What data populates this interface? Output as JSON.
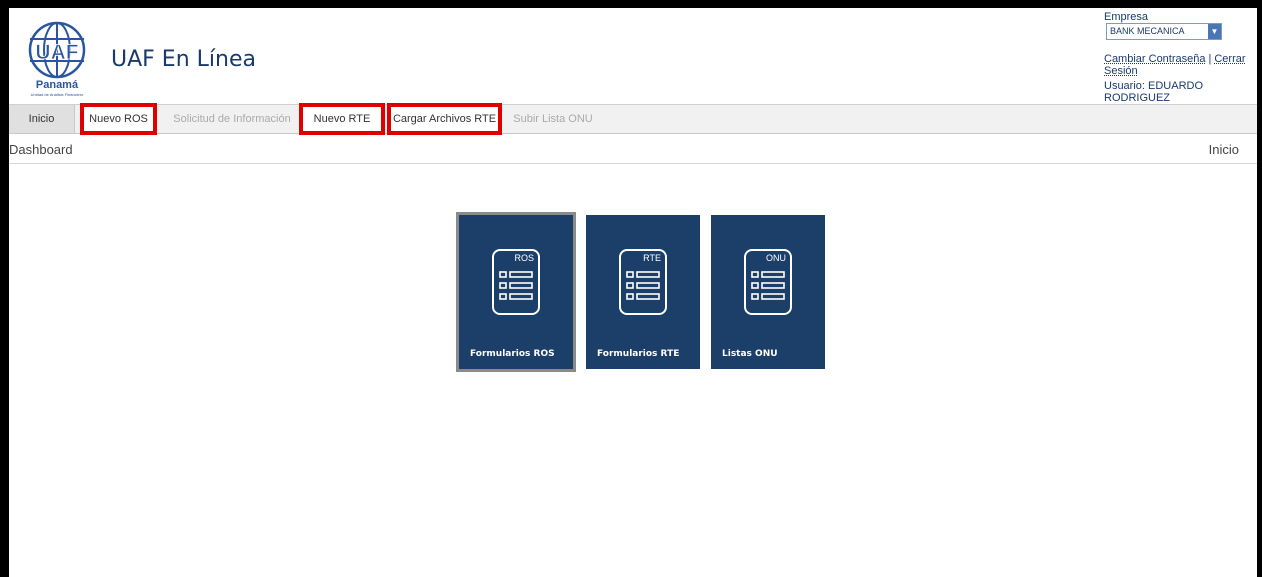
{
  "app": {
    "title": "UAF En Línea",
    "logo_text": "UAF",
    "logo_country": "Panamá",
    "logo_subtitle": "Unidad de Análisis Financiero"
  },
  "header": {
    "company_label": "Empresa",
    "company_value": "BANK MECANICA",
    "change_password": "Cambiar Contraseña",
    "separator": "|",
    "logout": "Cerrar Sesión",
    "user_label": "Usuario: EDUARDO RODRIGUEZ"
  },
  "tabs": [
    {
      "label": "Inicio",
      "state": "active"
    },
    {
      "label": "Nuevo ROS",
      "state": "highlighted"
    },
    {
      "label": "Solicitud de Información",
      "state": "disabled"
    },
    {
      "label": "Nuevo RTE",
      "state": "highlighted"
    },
    {
      "label": "Cargar Archivos RTE",
      "state": "highlighted"
    },
    {
      "label": "Subir Lista ONU",
      "state": "disabled"
    }
  ],
  "breadcrumb": {
    "left": "Dashboard",
    "right": "Inicio"
  },
  "tiles": [
    {
      "tag": "ROS",
      "label": "Formularios ROS",
      "icon": "form-list-icon"
    },
    {
      "tag": "RTE",
      "label": "Formularios RTE",
      "icon": "form-list-icon"
    },
    {
      "tag": "ONU",
      "label": "Listas ONU",
      "icon": "form-list-icon"
    }
  ],
  "colors": {
    "tile_bg": "#1b3f68",
    "highlight": "#e00000",
    "brand_blue": "#1a3a6b"
  }
}
